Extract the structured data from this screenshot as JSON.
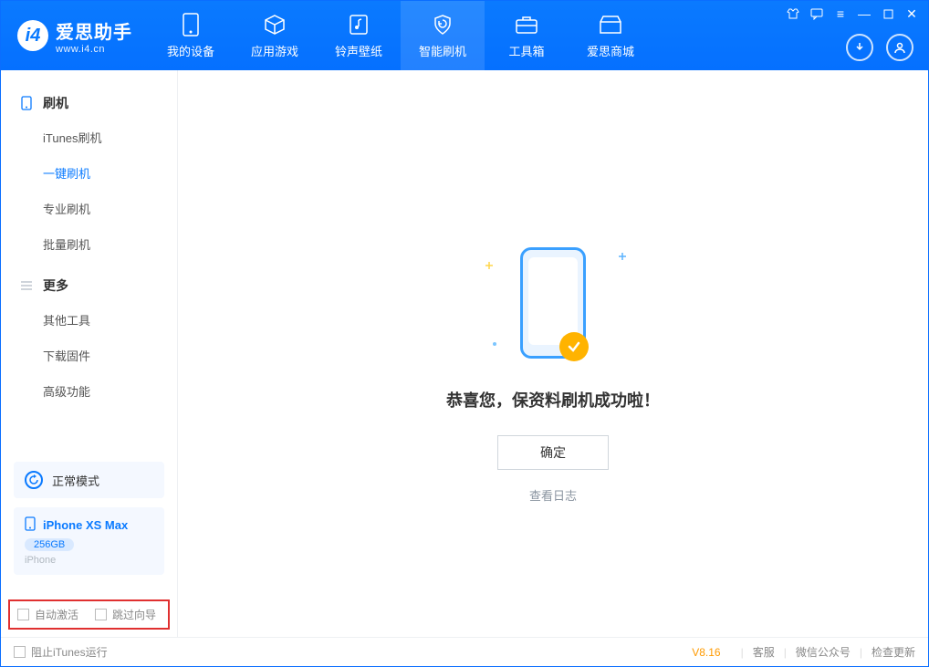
{
  "app": {
    "name": "爱思助手",
    "site": "www.i4.cn"
  },
  "header_tabs": {
    "device": "我的设备",
    "apps": "应用游戏",
    "ring": "铃声壁纸",
    "flash": "智能刷机",
    "toolbox": "工具箱",
    "store": "爱思商城"
  },
  "sidebar": {
    "group1_title": "刷机",
    "items1": {
      "itunes": "iTunes刷机",
      "onekey": "一键刷机",
      "pro": "专业刷机",
      "batch": "批量刷机"
    },
    "group2_title": "更多",
    "items2": {
      "other": "其他工具",
      "firmware": "下载固件",
      "advanced": "高级功能"
    }
  },
  "mode": {
    "label": "正常模式"
  },
  "device": {
    "name": "iPhone XS Max",
    "capacity": "256GB",
    "type": "iPhone"
  },
  "options": {
    "auto_activate": "自动激活",
    "skip_guide": "跳过向导"
  },
  "main": {
    "success_msg": "恭喜您，保资料刷机成功啦！",
    "ok": "确定",
    "view_log": "查看日志"
  },
  "footer": {
    "block_itunes": "阻止iTunes运行",
    "version": "V8.16",
    "support": "客服",
    "wechat": "微信公众号",
    "update": "检查更新"
  }
}
